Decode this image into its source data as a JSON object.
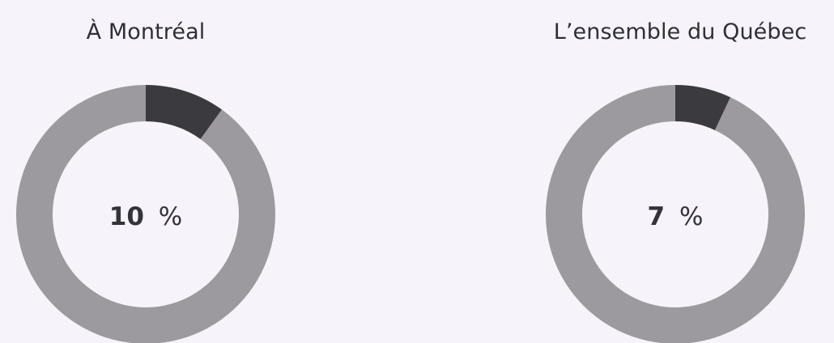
{
  "chart_data": [
    {
      "type": "pie",
      "title": "À Montréal",
      "center_label": {
        "value": "10",
        "unit": "%"
      },
      "categories": [
        "",
        ""
      ],
      "values": [
        10,
        90
      ],
      "colors": [
        "#3b3b3f",
        "#9c9a9f"
      ],
      "donut": true
    },
    {
      "type": "pie",
      "title": "L’ensemble du Québec",
      "center_label": {
        "value": "7",
        "unit": "%"
      },
      "categories": [
        "",
        ""
      ],
      "values": [
        7,
        93
      ],
      "colors": [
        "#3b3b3f",
        "#9c9a9f"
      ],
      "donut": true
    }
  ],
  "colors": {
    "background": "#f6f3fa",
    "text": "#2f2f35"
  }
}
